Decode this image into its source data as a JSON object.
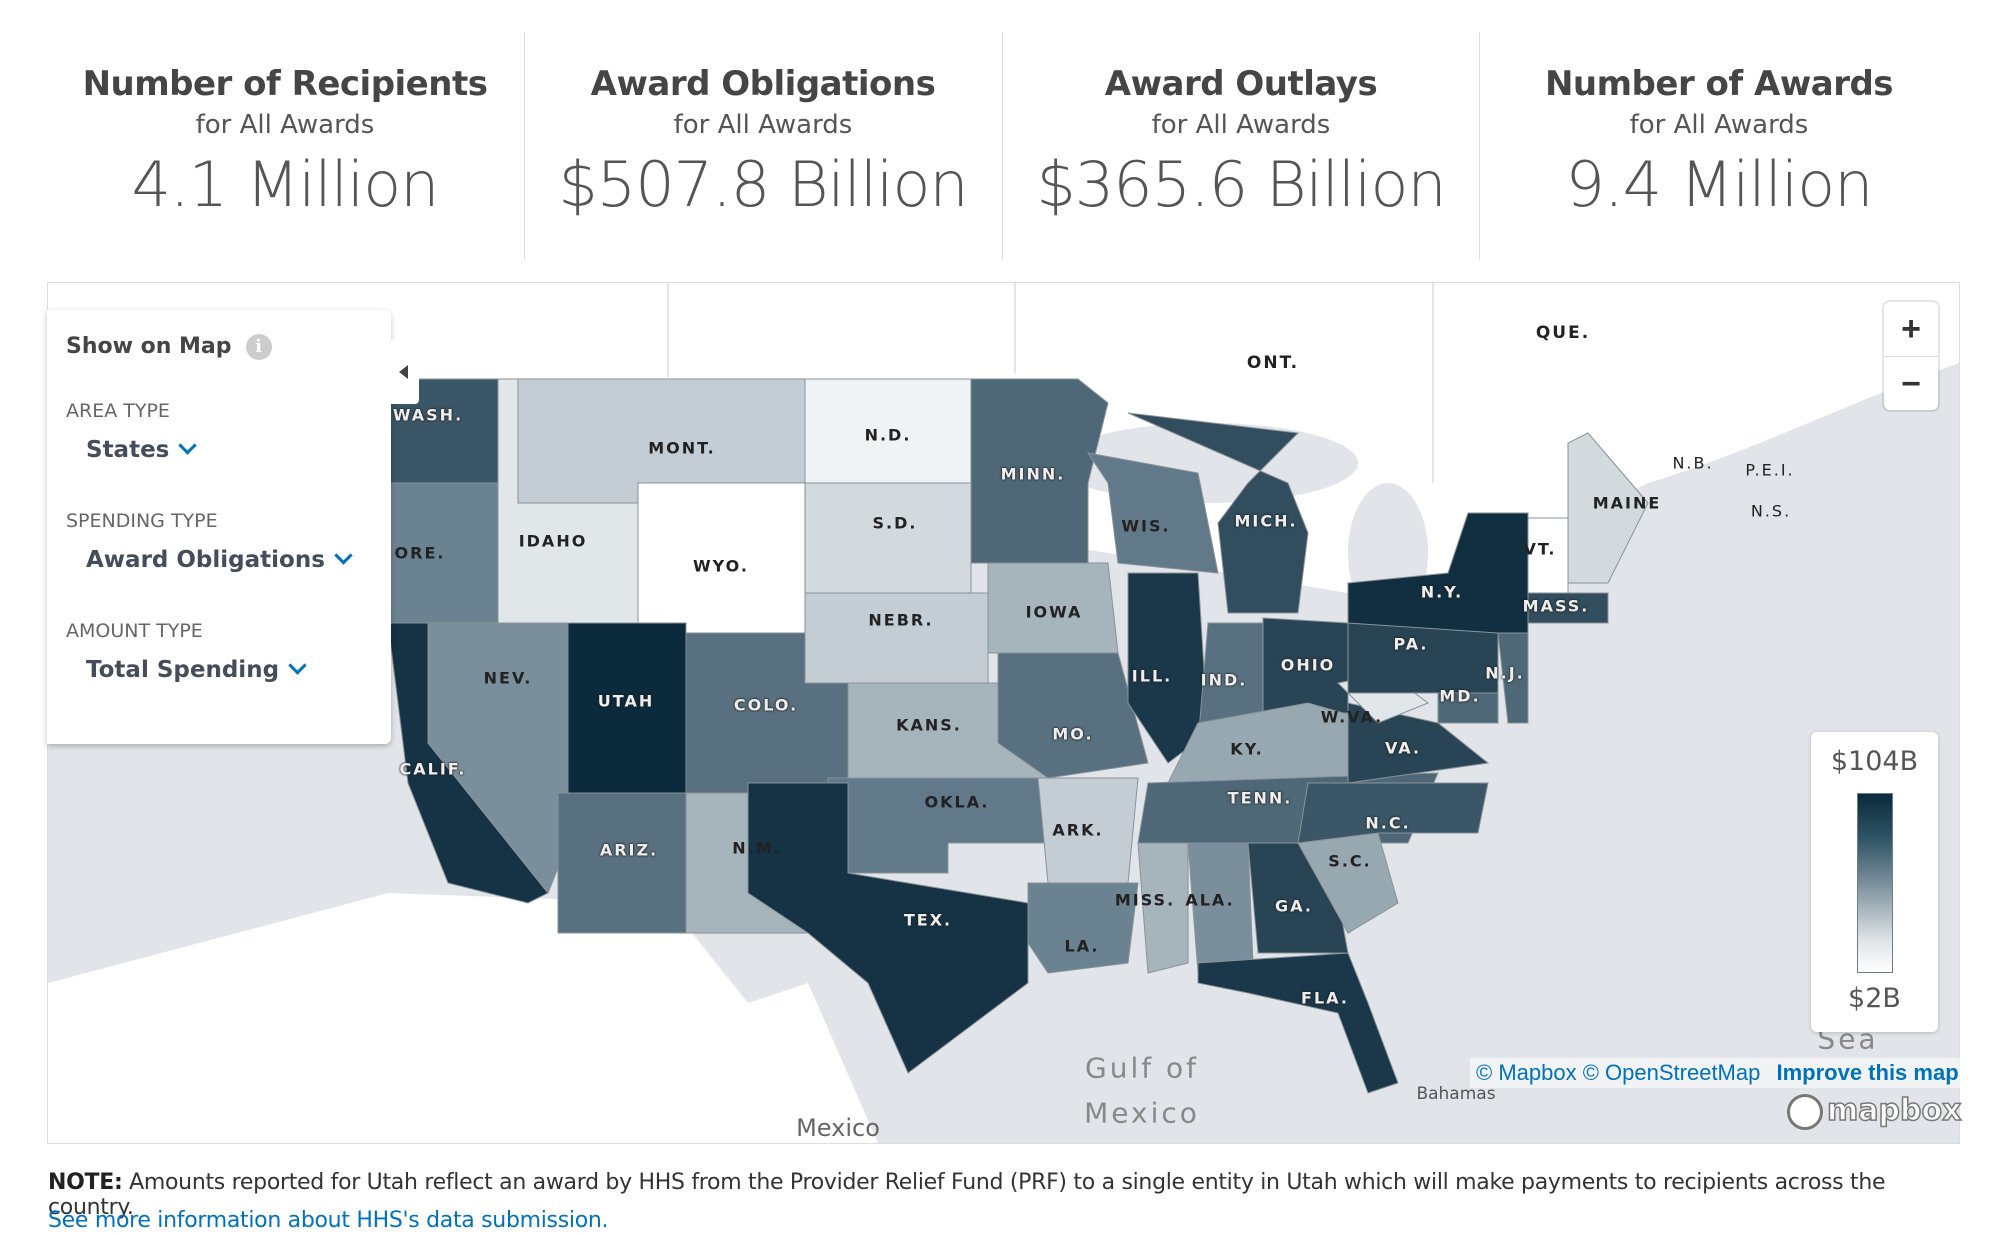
{
  "stats": [
    {
      "title": "Number of Recipients",
      "subtitle": "for All Awards",
      "value": "4.1 Million"
    },
    {
      "title": "Award Obligations",
      "subtitle": "for All Awards",
      "value": "$507.8 Billion"
    },
    {
      "title": "Award Outlays",
      "subtitle": "for All Awards",
      "value": "$365.6 Billion"
    },
    {
      "title": "Number of Awards",
      "subtitle": "for All Awards",
      "value": "9.4 Million"
    }
  ],
  "panel": {
    "title": "Show on Map",
    "info_icon": "info-icon",
    "area_type_label": "AREA TYPE",
    "area_type_value": "States",
    "spending_type_label": "SPENDING TYPE",
    "spending_type_value": "Award Obligations",
    "amount_type_label": "AMOUNT TYPE",
    "amount_type_value": "Total Spending"
  },
  "zoom": {
    "in": "+",
    "out": "−"
  },
  "legend": {
    "max": "$104B",
    "min": "$2B",
    "color_low": "#ffffff",
    "color_high": "#0b2a3c"
  },
  "geo_labels": {
    "ont": "ONT.",
    "que": "QUE.",
    "nb": "N.B.",
    "pei": "P.E.I.",
    "ns": "N.S.",
    "gulf1": "Gulf of",
    "gulf2": "Mexico",
    "mexico": "Mexico",
    "bahamas": "Bahamas",
    "sea": "Sea"
  },
  "states": [
    {
      "label": "WASH.",
      "shade": 0.75
    },
    {
      "label": "ORE.",
      "shade": 0.5
    },
    {
      "label": "CALIF.",
      "shade": 0.95
    },
    {
      "label": "IDAHO",
      "shade": 0.1
    },
    {
      "label": "NEV.",
      "shade": 0.45
    },
    {
      "label": "MONT.",
      "shade": 0.2
    },
    {
      "label": "WYO.",
      "shade": 0.0
    },
    {
      "label": "UTAH",
      "shade": 1.0
    },
    {
      "label": "COLO.",
      "shade": 0.6
    },
    {
      "label": "ARIZ.",
      "shade": 0.6
    },
    {
      "label": "N.M.",
      "shade": 0.3
    },
    {
      "label": "N.D.",
      "shade": 0.05
    },
    {
      "label": "S.D.",
      "shade": 0.15
    },
    {
      "label": "NEBR.",
      "shade": 0.2
    },
    {
      "label": "KANS.",
      "shade": 0.3
    },
    {
      "label": "OKLA.",
      "shade": 0.55
    },
    {
      "label": "TEX.",
      "shade": 0.95
    },
    {
      "label": "MINN.",
      "shade": 0.65
    },
    {
      "label": "IOWA",
      "shade": 0.3
    },
    {
      "label": "MO.",
      "shade": 0.6
    },
    {
      "label": "ARK.",
      "shade": 0.2
    },
    {
      "label": "LA.",
      "shade": 0.5
    },
    {
      "label": "WIS.",
      "shade": 0.55
    },
    {
      "label": "ILL.",
      "shade": 0.92
    },
    {
      "label": "MICH.",
      "shade": 0.8
    },
    {
      "label": "IND.",
      "shade": 0.6
    },
    {
      "label": "OHIO",
      "shade": 0.85
    },
    {
      "label": "KY.",
      "shade": 0.35
    },
    {
      "label": "TENN.",
      "shade": 0.65
    },
    {
      "label": "MISS.",
      "shade": 0.3
    },
    {
      "label": "ALA.",
      "shade": 0.45
    },
    {
      "label": "GA.",
      "shade": 0.85
    },
    {
      "label": "FLA.",
      "shade": 0.92
    },
    {
      "label": "S.C.",
      "shade": 0.35
    },
    {
      "label": "N.C.",
      "shade": 0.75
    },
    {
      "label": "VA.",
      "shade": 0.85
    },
    {
      "label": "W.VA.",
      "shade": 0.1
    },
    {
      "label": "PA.",
      "shade": 0.85
    },
    {
      "label": "N.Y.",
      "shade": 0.97
    },
    {
      "label": "N.J.",
      "shade": 0.65
    },
    {
      "label": "MD.",
      "shade": 0.65
    },
    {
      "label": "MASS.",
      "shade": 0.8
    },
    {
      "label": "VT.",
      "shade": 0.0
    },
    {
      "label": "MAINE",
      "shade": 0.15
    }
  ],
  "attribution": {
    "mapbox": "© Mapbox",
    "osm": "© OpenStreetMap",
    "improve": "Improve this map",
    "logo": "mapbox"
  },
  "note": {
    "label": "NOTE:",
    "text": " Amounts reported for Utah reflect an award by HHS from the Provider Relief Fund (PRF) to a single entity in Utah which will make payments to recipients across the country.",
    "link": "See more information about HHS's data submission."
  }
}
